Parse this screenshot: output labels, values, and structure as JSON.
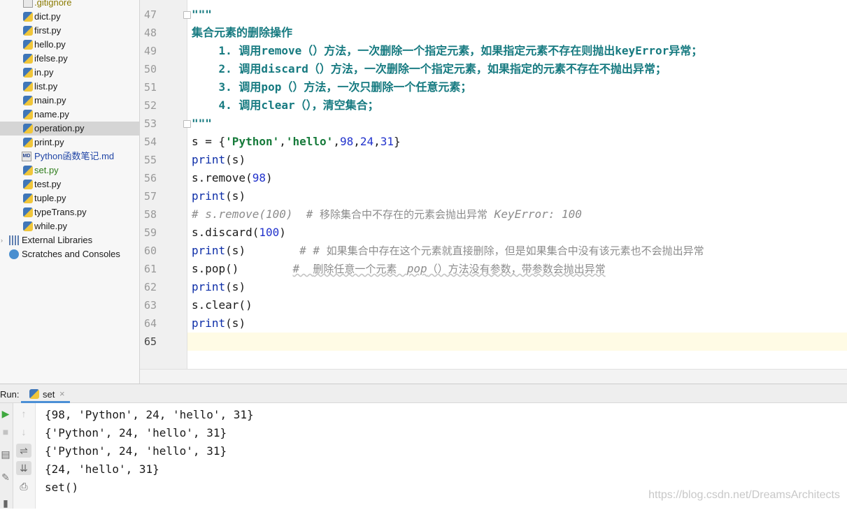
{
  "project_tree": {
    "files": [
      {
        "label": ".gitignore",
        "icon": "gitignore-file-icon",
        "status": "ignored"
      },
      {
        "label": "dict.py",
        "icon": "python-file-icon",
        "status": "normal"
      },
      {
        "label": "first.py",
        "icon": "python-file-icon",
        "status": "normal"
      },
      {
        "label": "hello.py",
        "icon": "python-file-icon",
        "status": "normal"
      },
      {
        "label": "ifelse.py",
        "icon": "python-file-icon",
        "status": "normal"
      },
      {
        "label": "in.py",
        "icon": "python-file-icon",
        "status": "normal"
      },
      {
        "label": "list.py",
        "icon": "python-file-icon",
        "status": "normal"
      },
      {
        "label": "main.py",
        "icon": "python-file-icon",
        "status": "normal"
      },
      {
        "label": "name.py",
        "icon": "python-file-icon",
        "status": "normal"
      },
      {
        "label": "operation.py",
        "icon": "python-file-icon",
        "status": "selected"
      },
      {
        "label": "print.py",
        "icon": "python-file-icon",
        "status": "normal"
      },
      {
        "label": "Python函数笔记.md",
        "icon": "markdown-file-icon",
        "status": "md"
      },
      {
        "label": "set.py",
        "icon": "python-file-icon",
        "status": "added"
      },
      {
        "label": "test.py",
        "icon": "python-file-icon",
        "status": "normal"
      },
      {
        "label": "tuple.py",
        "icon": "python-file-icon",
        "status": "normal"
      },
      {
        "label": "typeTrans.py",
        "icon": "python-file-icon",
        "status": "normal"
      },
      {
        "label": "while.py",
        "icon": "python-file-icon",
        "status": "normal"
      }
    ],
    "external_libraries": "External Libraries",
    "scratches": "Scratches and Consoles"
  },
  "editor": {
    "line_numbers": [
      "47",
      "48",
      "49",
      "50",
      "51",
      "52",
      "53",
      "54",
      "55",
      "56",
      "57",
      "58",
      "59",
      "60",
      "61",
      "62",
      "63",
      "64",
      "65"
    ],
    "current_line": "65",
    "lines": {
      "l47": "\"\"\"",
      "l48": "集合元素的删除操作",
      "l49": "    1. 调用remove（）方法，一次删除一个指定元素，如果指定元素不存在则抛出keyError异常；",
      "l50": "    2. 调用discard（）方法，一次删除一个指定元素，如果指定的元素不存在不抛出异常；",
      "l51": "    3. 调用pop（）方法，一次只删除一个任意元素；",
      "l52": "    4. 调用clear（），清空集合；",
      "l53": "\"\"\"",
      "l54": {
        "a": "s = {",
        "s1": "'Python'",
        "c1": ",",
        "s2": "'hello'",
        "c2": ",",
        "n1": "98",
        "c3": ",",
        "n2": "24",
        "c4": ",",
        "n3": "31",
        "b": "}"
      },
      "l55": {
        "fn": "print",
        "rest": "(s)"
      },
      "l56": {
        "a": "s.remove(",
        "n": "98",
        "b": ")"
      },
      "l57": {
        "fn": "print",
        "rest": "(s)"
      },
      "l58": {
        "code": "# s.remove(100)  # ",
        "cjk": "移除集合中不存在的元素会抛出异常",
        "tail": " KeyError: 100"
      },
      "l59": {
        "a": "s.discard(",
        "n": "100",
        "b": ")"
      },
      "l60": {
        "fn": "print",
        "rest": "(s)        ",
        "hash": "# # ",
        "cjk": "如果集合中存在这个元素就直接删除，但是如果集合中没有该元素也不会抛出异常"
      },
      "l61": {
        "code": "s.pop()        ",
        "hash": "#  ",
        "cjk1": "删除任意一个元素   ",
        "pop": "pop",
        "cjk2": "（）方法没有参数，带参数会抛出异常"
      },
      "l62": {
        "fn": "print",
        "rest": "(s)"
      },
      "l63": "s.clear()",
      "l64": {
        "fn": "print",
        "rest": "(s)"
      }
    }
  },
  "run_panel": {
    "label": "Run:",
    "tab_name": "set",
    "output": [
      "{98, 'Python', 24, 'hello', 31}",
      "{'Python', 24, 'hello', 31}",
      "{'Python', 24, 'hello', 31}",
      "{24, 'hello', 31}",
      "set()"
    ]
  },
  "watermark": "https://blog.csdn.net/DreamsArchitects"
}
